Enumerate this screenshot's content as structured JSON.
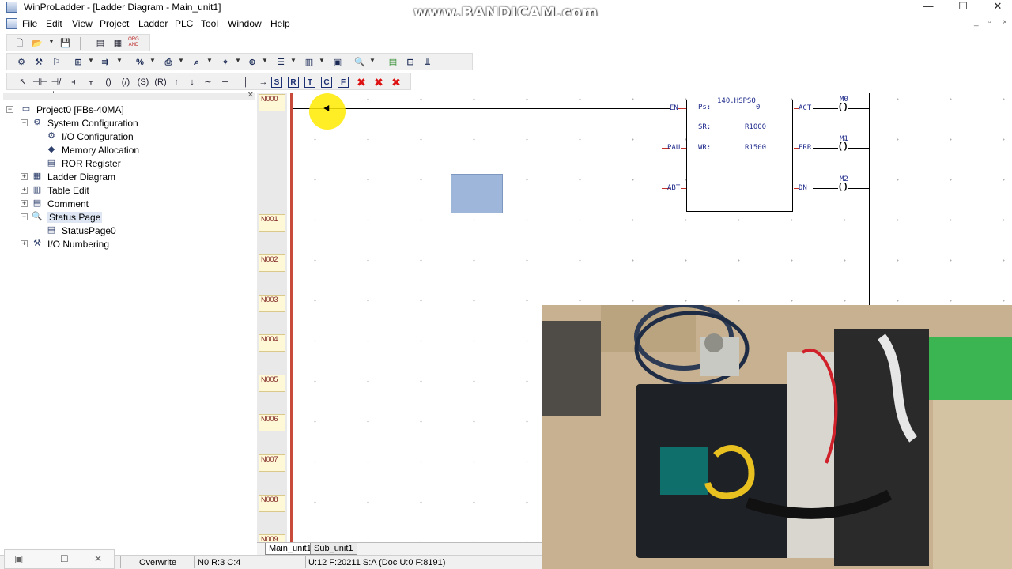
{
  "window": {
    "title": "WinProLadder - [Ladder Diagram - Main_unit1]",
    "watermark": "www.BANDICAM.com",
    "controls": [
      "—",
      "☐",
      "✕"
    ],
    "mdi_controls": [
      "_",
      "▫",
      "×"
    ]
  },
  "menu": [
    "File",
    "Edit",
    "View",
    "Project",
    "Ladder",
    "PLC",
    "Tool",
    "Window",
    "Help"
  ],
  "toolbar_extra": {
    "org_and": "ORG AND"
  },
  "instr_toolbar": {
    "letters": [
      "S",
      "R",
      "T",
      "C",
      "F"
    ]
  },
  "tree": {
    "items": [
      {
        "label": "Project0 [FBs-40MA]",
        "icon": "project-icon",
        "twisty": "−"
      },
      {
        "label": "System Configuration",
        "icon": "system-config-icon",
        "twisty": "−"
      },
      {
        "label": "I/O Configuration",
        "icon": "io-config-icon",
        "twisty": ""
      },
      {
        "label": "Memory Allocation",
        "icon": "memory-icon",
        "twisty": ""
      },
      {
        "label": "ROR Register",
        "icon": "register-icon",
        "twisty": ""
      },
      {
        "label": "Ladder Diagram",
        "icon": "ladder-icon",
        "twisty": "+"
      },
      {
        "label": "Table Edit",
        "icon": "table-icon",
        "twisty": "+"
      },
      {
        "label": "Comment",
        "icon": "comment-icon",
        "twisty": "+"
      },
      {
        "label": "Status Page",
        "icon": "status-page-icon",
        "twisty": "−"
      },
      {
        "label": "StatusPage0",
        "icon": "status-icon",
        "twisty": ""
      },
      {
        "label": "I/O Numbering",
        "icon": "io-numbering-icon",
        "twisty": "+"
      }
    ]
  },
  "ladder": {
    "rungs": [
      "N000",
      "N001",
      "N002",
      "N003",
      "N004",
      "N005",
      "N006",
      "N007",
      "N008",
      "N009"
    ],
    "function_block": {
      "title": "140.HSPSO",
      "ps_label": "Ps:",
      "ps_value": "0",
      "sr_label": "SR:",
      "sr_value": "R1000",
      "wr_label": "WR:",
      "wr_value": "R1500",
      "inputs": [
        "EN",
        "PAU",
        "ABT"
      ],
      "outputs": [
        "ACT",
        "ERR",
        "DN"
      ]
    },
    "coils": [
      "M0",
      "M1",
      "M2"
    ]
  },
  "sheet_tabs": [
    "Main_unit1",
    "Sub_unit1"
  ],
  "status": {
    "mode": "Overwrite",
    "position": "N0 R:3 C:4",
    "usage": "U:12 F:20211 S:A (Doc U:0 F:8191)"
  }
}
